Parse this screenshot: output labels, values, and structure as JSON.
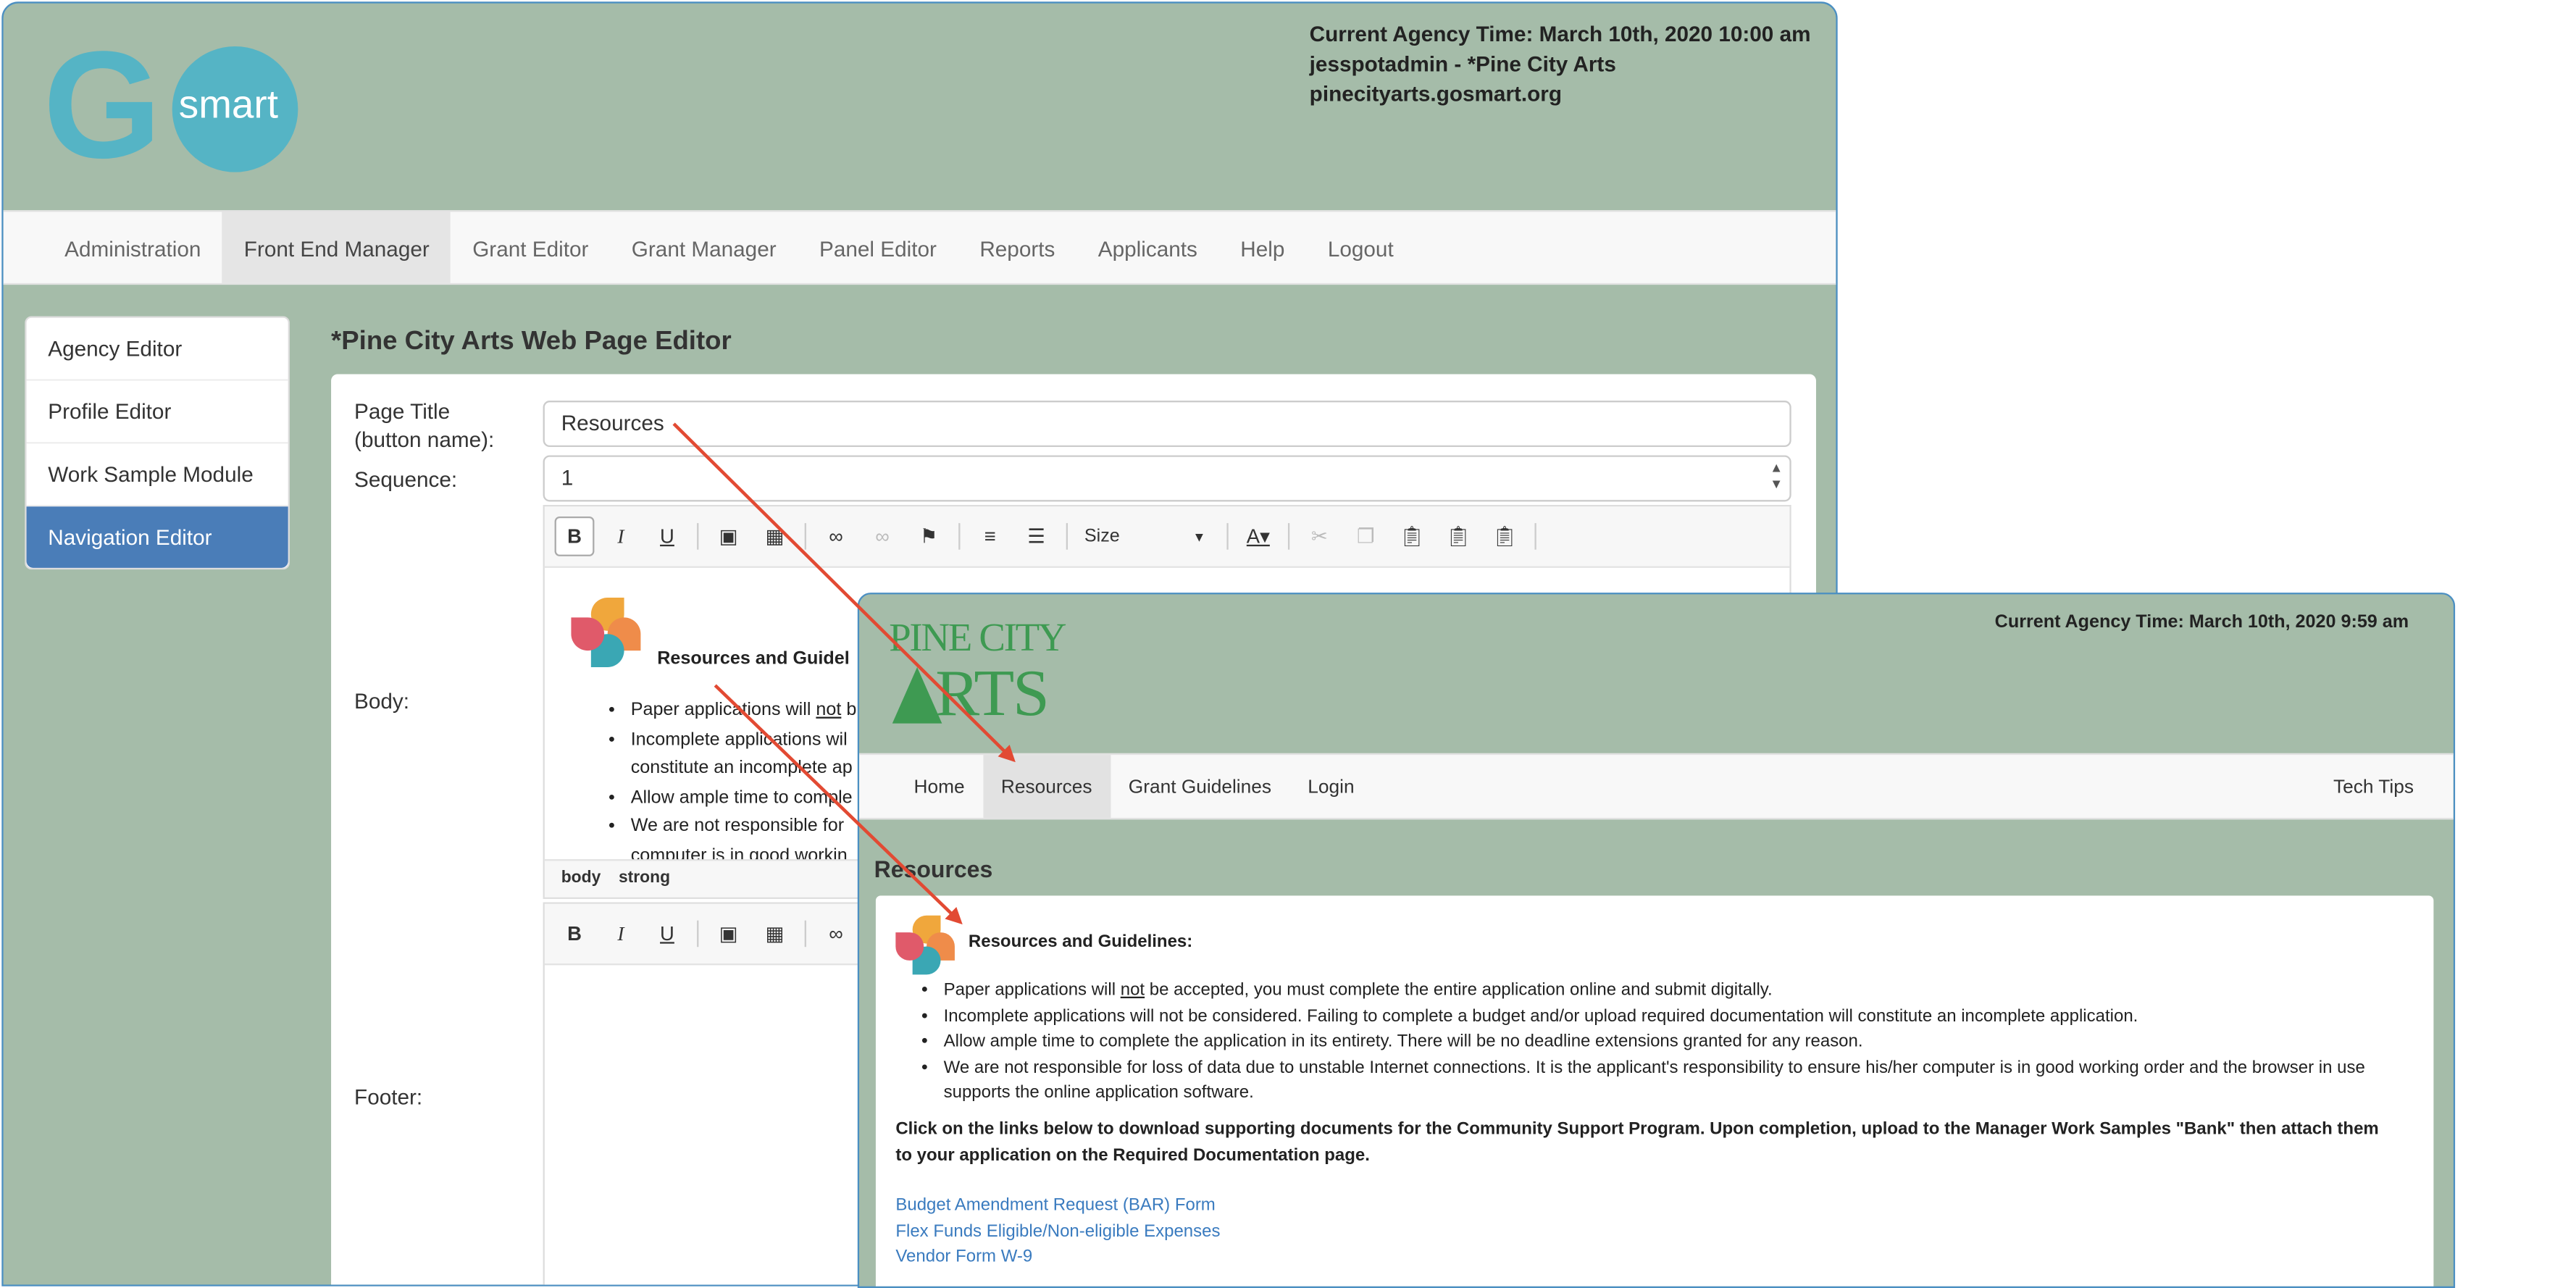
{
  "back_window": {
    "logo": {
      "g": "G",
      "smart": "smart"
    },
    "agency_info": [
      "Current Agency Time: March 10th, 2020 10:00 am",
      "jesspotadmin - *Pine City Arts",
      "pinecityarts.gosmart.org"
    ],
    "nav": [
      "Administration",
      "Front End Manager",
      "Grant Editor",
      "Grant Manager",
      "Panel Editor",
      "Reports",
      "Applicants",
      "Help",
      "Logout"
    ],
    "sidebar": [
      "Agency Editor",
      "Profile Editor",
      "Work Sample Module",
      "Navigation Editor"
    ],
    "page_title": "*Pine City Arts Web Page Editor",
    "form": {
      "page_title_label_1": "Page Title",
      "page_title_label_2": "(button name):",
      "page_title_value": "Resources",
      "sequence_label": "Sequence:",
      "sequence_value": "1",
      "body_label": "Body:",
      "footer_label": "Footer:"
    },
    "editor": {
      "size_label": "Size",
      "heading_part1": "Resources ",
      "heading_part2": "and Guidel",
      "bullets": [
        {
          "pre": "Paper applications will ",
          "u": "not",
          "post": " b"
        },
        {
          "pre": "Incomplete applications wil",
          "u": "",
          "post": ""
        },
        {
          "pre": "constitute an incomplete ap",
          "u": "",
          "post": ""
        },
        {
          "pre": "Allow ample time to comple",
          "u": "",
          "post": ""
        },
        {
          "pre": "We are not responsible for",
          "u": "",
          "post": ""
        },
        {
          "pre": "computer is in good workin",
          "u": "",
          "post": ""
        }
      ],
      "status": [
        "body",
        "strong"
      ]
    }
  },
  "front_window": {
    "logo": {
      "line1": "PINE CITY",
      "line2": "RTS"
    },
    "agency_time": "Current Agency Time: March 10th, 2020 9:59 am",
    "nav": [
      "Home",
      "Resources",
      "Grant Guidelines",
      "Login"
    ],
    "tech_tips": "Tech Tips",
    "page_title": "Resources",
    "heading": "Resources and Guidelines:",
    "bullets": [
      {
        "pre": "Paper applications will ",
        "u": "not",
        "post": " be accepted, you must complete the entire application online and submit digitally."
      },
      {
        "pre": "Incomplete applications will not be considered. Failing to complete a budget and/or upload required documentation will constitute an incomplete application.",
        "u": "",
        "post": ""
      },
      {
        "pre": "Allow ample time to complete the application in its entirety. There will be no deadline extensions granted for any reason.",
        "u": "",
        "post": ""
      },
      {
        "pre": "We are not responsible for loss of data due to unstable Internet connections. It is the applicant's responsibility to ensure his/her computer is in good working order and the browser in use supports the online application software.",
        "u": "",
        "post": ""
      }
    ],
    "bold_text": "Click on the links below to download supporting documents for the Community Support Program. Upon completion, upload to the Manager Work Samples \"Bank\" then attach them to your application on the Required Documentation page.",
    "links": [
      "Budget Amendment Request (BAR) Form",
      "Flex Funds Eligible/Non-eligible Expenses",
      "Vendor Form W-9"
    ]
  },
  "colors": {
    "header_bg": "#a5bca9",
    "accent": "#4a7db8",
    "logo_teal": "#55b4c5",
    "arrow": "#e24a33",
    "link": "#3a7bbf"
  }
}
